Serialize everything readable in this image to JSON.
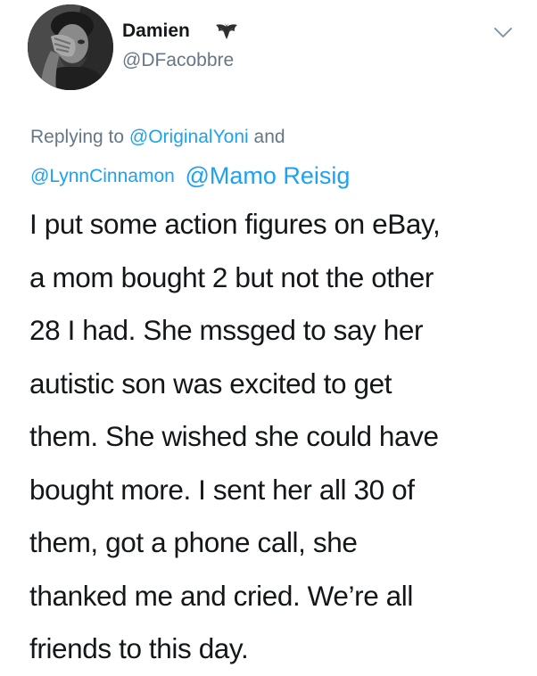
{
  "author": {
    "display_name": "Damien",
    "handle": "@DFacobbre",
    "name_emoji": "bat-emoji"
  },
  "reply": {
    "prefix": "Replying to",
    "mention1": "@OriginalYoni",
    "conjunction": "and",
    "mention2": "@LynnCinnamon",
    "mention3": "@Mamo Reisig"
  },
  "tweet": {
    "lines": [
      "I put some action figures on eBay,",
      "a mom bought 2 but not the other",
      "28 I had. She mssged to say her",
      "autistic son was excited to get",
      "them. She wished she could have",
      "bought more. I sent her all 30 of",
      "them, got a phone call, she",
      "thanked me and cried. We’re all",
      "friends to this day."
    ]
  },
  "icons": {
    "menu": "chevron-down-icon"
  },
  "colors": {
    "text": "#14171a",
    "secondary": "#657786",
    "link": "#1da1f2",
    "background": "#ffffff"
  }
}
